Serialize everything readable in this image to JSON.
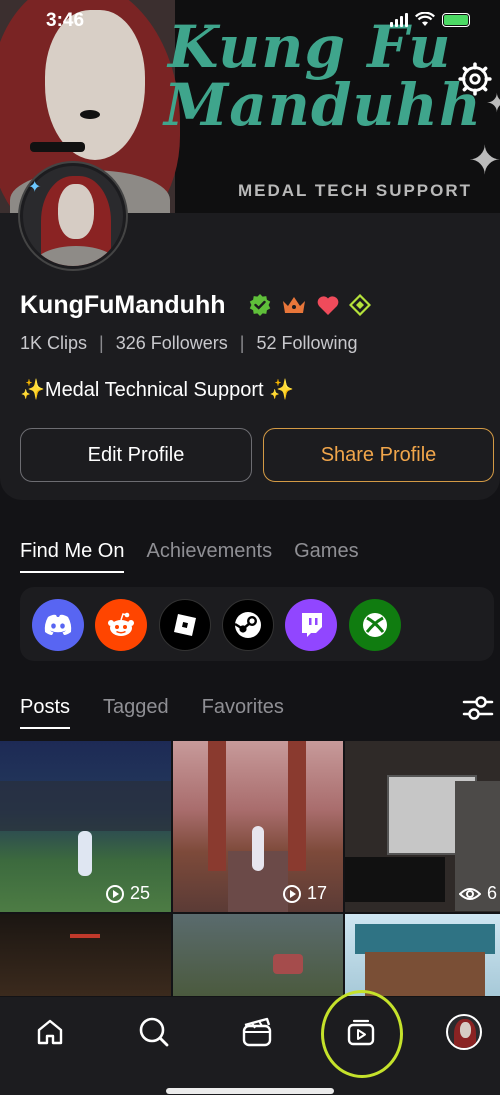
{
  "status_bar": {
    "time": "3:46"
  },
  "banner": {
    "title_line1": "Kung Fu",
    "title_line2": "Manduhh",
    "subtitle": "MEDAL TECH SUPPORT"
  },
  "profile": {
    "username": "KungFuManduhh",
    "clips": "1K Clips",
    "followers": "326 Followers",
    "following": "52 Following",
    "separator": "|",
    "bio": "✨Medal Technical Support ✨",
    "edit_label": "Edit Profile",
    "share_label": "Share Profile"
  },
  "section_tabs": [
    {
      "label": "Find Me On",
      "active": true
    },
    {
      "label": "Achievements",
      "active": false
    },
    {
      "label": "Games",
      "active": false
    }
  ],
  "socials": [
    {
      "name": "discord",
      "color": "#5865F2"
    },
    {
      "name": "reddit",
      "color": "#FF4500"
    },
    {
      "name": "roblox",
      "color": "#000000"
    },
    {
      "name": "steam",
      "color": "#000000"
    },
    {
      "name": "twitch",
      "color": "#9146FF"
    },
    {
      "name": "xbox",
      "color": "#107C10"
    }
  ],
  "post_tabs": [
    {
      "label": "Posts",
      "active": true
    },
    {
      "label": "Tagged",
      "active": false
    },
    {
      "label": "Favorites",
      "active": false
    }
  ],
  "posts": [
    {
      "views": "25"
    },
    {
      "views": "17"
    },
    {
      "views": "6"
    },
    {
      "views": ""
    },
    {
      "views": ""
    },
    {
      "views": ""
    }
  ],
  "nav": [
    "home-icon",
    "search-icon",
    "clips-icon",
    "library-icon",
    "profile-avatar"
  ],
  "colors": {
    "accent_orange": "#f1a64b",
    "verified_green": "#5fbf3a",
    "highlight": "#c5e22b"
  }
}
